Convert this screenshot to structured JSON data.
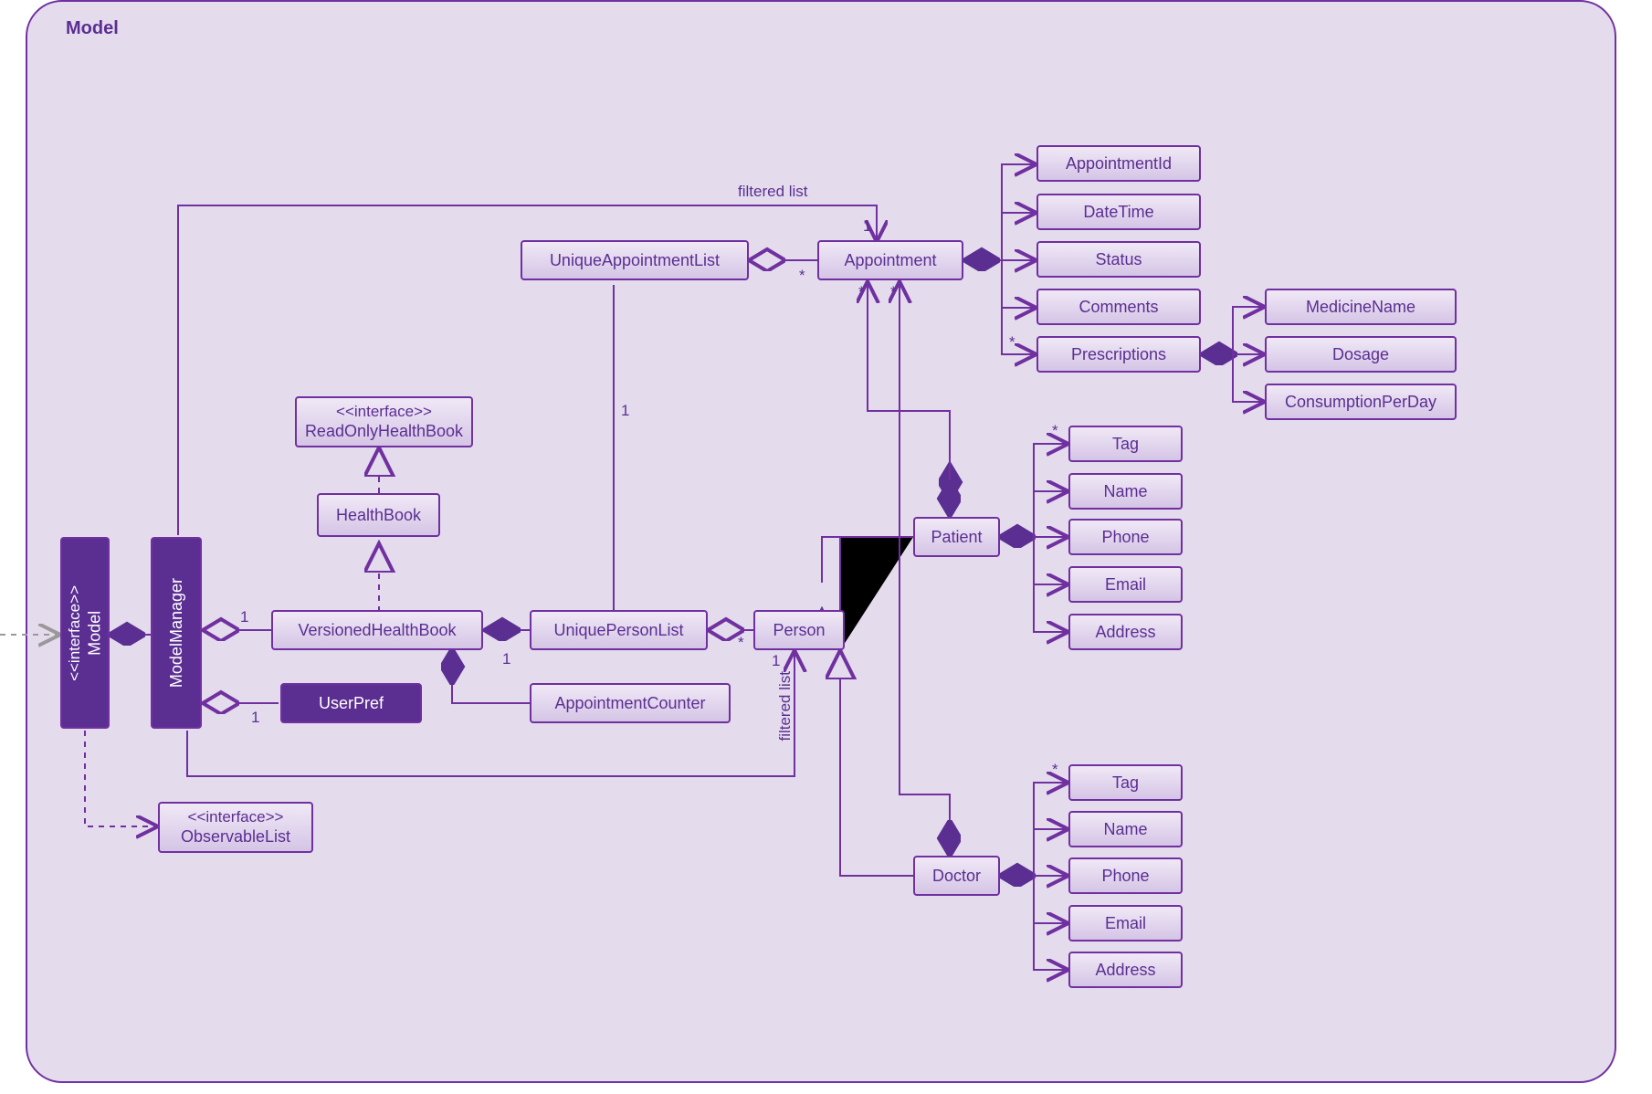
{
  "package": {
    "title": "Model"
  },
  "boxes": {
    "modelInterface": {
      "stereotype": "<<interface>>",
      "name": "Model"
    },
    "modelManager": {
      "name": "ModelManager"
    },
    "observableList": {
      "stereotype": "<<interface>>",
      "name": "ObservableList"
    },
    "readOnlyHealthBook": {
      "stereotype": "<<interface>>",
      "name": "ReadOnlyHealthBook"
    },
    "healthBook": {
      "name": "HealthBook"
    },
    "versionedHealthBook": {
      "name": "VersionedHealthBook"
    },
    "userPref": {
      "name": "UserPref"
    },
    "appointmentCounter": {
      "name": "AppointmentCounter"
    },
    "uniquePersonList": {
      "name": "UniquePersonList"
    },
    "person": {
      "name": "Person"
    },
    "uniqueAppointmentList": {
      "name": "UniqueAppointmentList"
    },
    "appointment": {
      "name": "Appointment"
    },
    "appointmentId": {
      "name": "AppointmentId"
    },
    "dateTime": {
      "name": "DateTime"
    },
    "status": {
      "name": "Status"
    },
    "comments": {
      "name": "Comments"
    },
    "prescriptions": {
      "name": "Prescriptions"
    },
    "medicineName": {
      "name": "MedicineName"
    },
    "dosage": {
      "name": "Dosage"
    },
    "consumptionPerDay": {
      "name": "ConsumptionPerDay"
    },
    "patient": {
      "name": "Patient"
    },
    "doctor": {
      "name": "Doctor"
    },
    "p_tag": {
      "name": "Tag"
    },
    "p_name": {
      "name": "Name"
    },
    "p_phone": {
      "name": "Phone"
    },
    "p_email": {
      "name": "Email"
    },
    "p_address": {
      "name": "Address"
    },
    "d_tag": {
      "name": "Tag"
    },
    "d_name": {
      "name": "Name"
    },
    "d_phone": {
      "name": "Phone"
    },
    "d_email": {
      "name": "Email"
    },
    "d_address": {
      "name": "Address"
    }
  },
  "labels": {
    "filteredListApt": "filtered list",
    "filteredListPerson": "filtered list",
    "mmVHB": "1",
    "mmUP": "1",
    "vhbUAL": "1",
    "vhbUPL": "1",
    "ualApt": "1",
    "ualAptStar": "*",
    "uplPerson": "*",
    "personMult": "1",
    "aptPatientStar": "*",
    "aptDoctorStar": "*",
    "presStar": "*",
    "pTagStar": "*",
    "dTagStar": "*"
  }
}
